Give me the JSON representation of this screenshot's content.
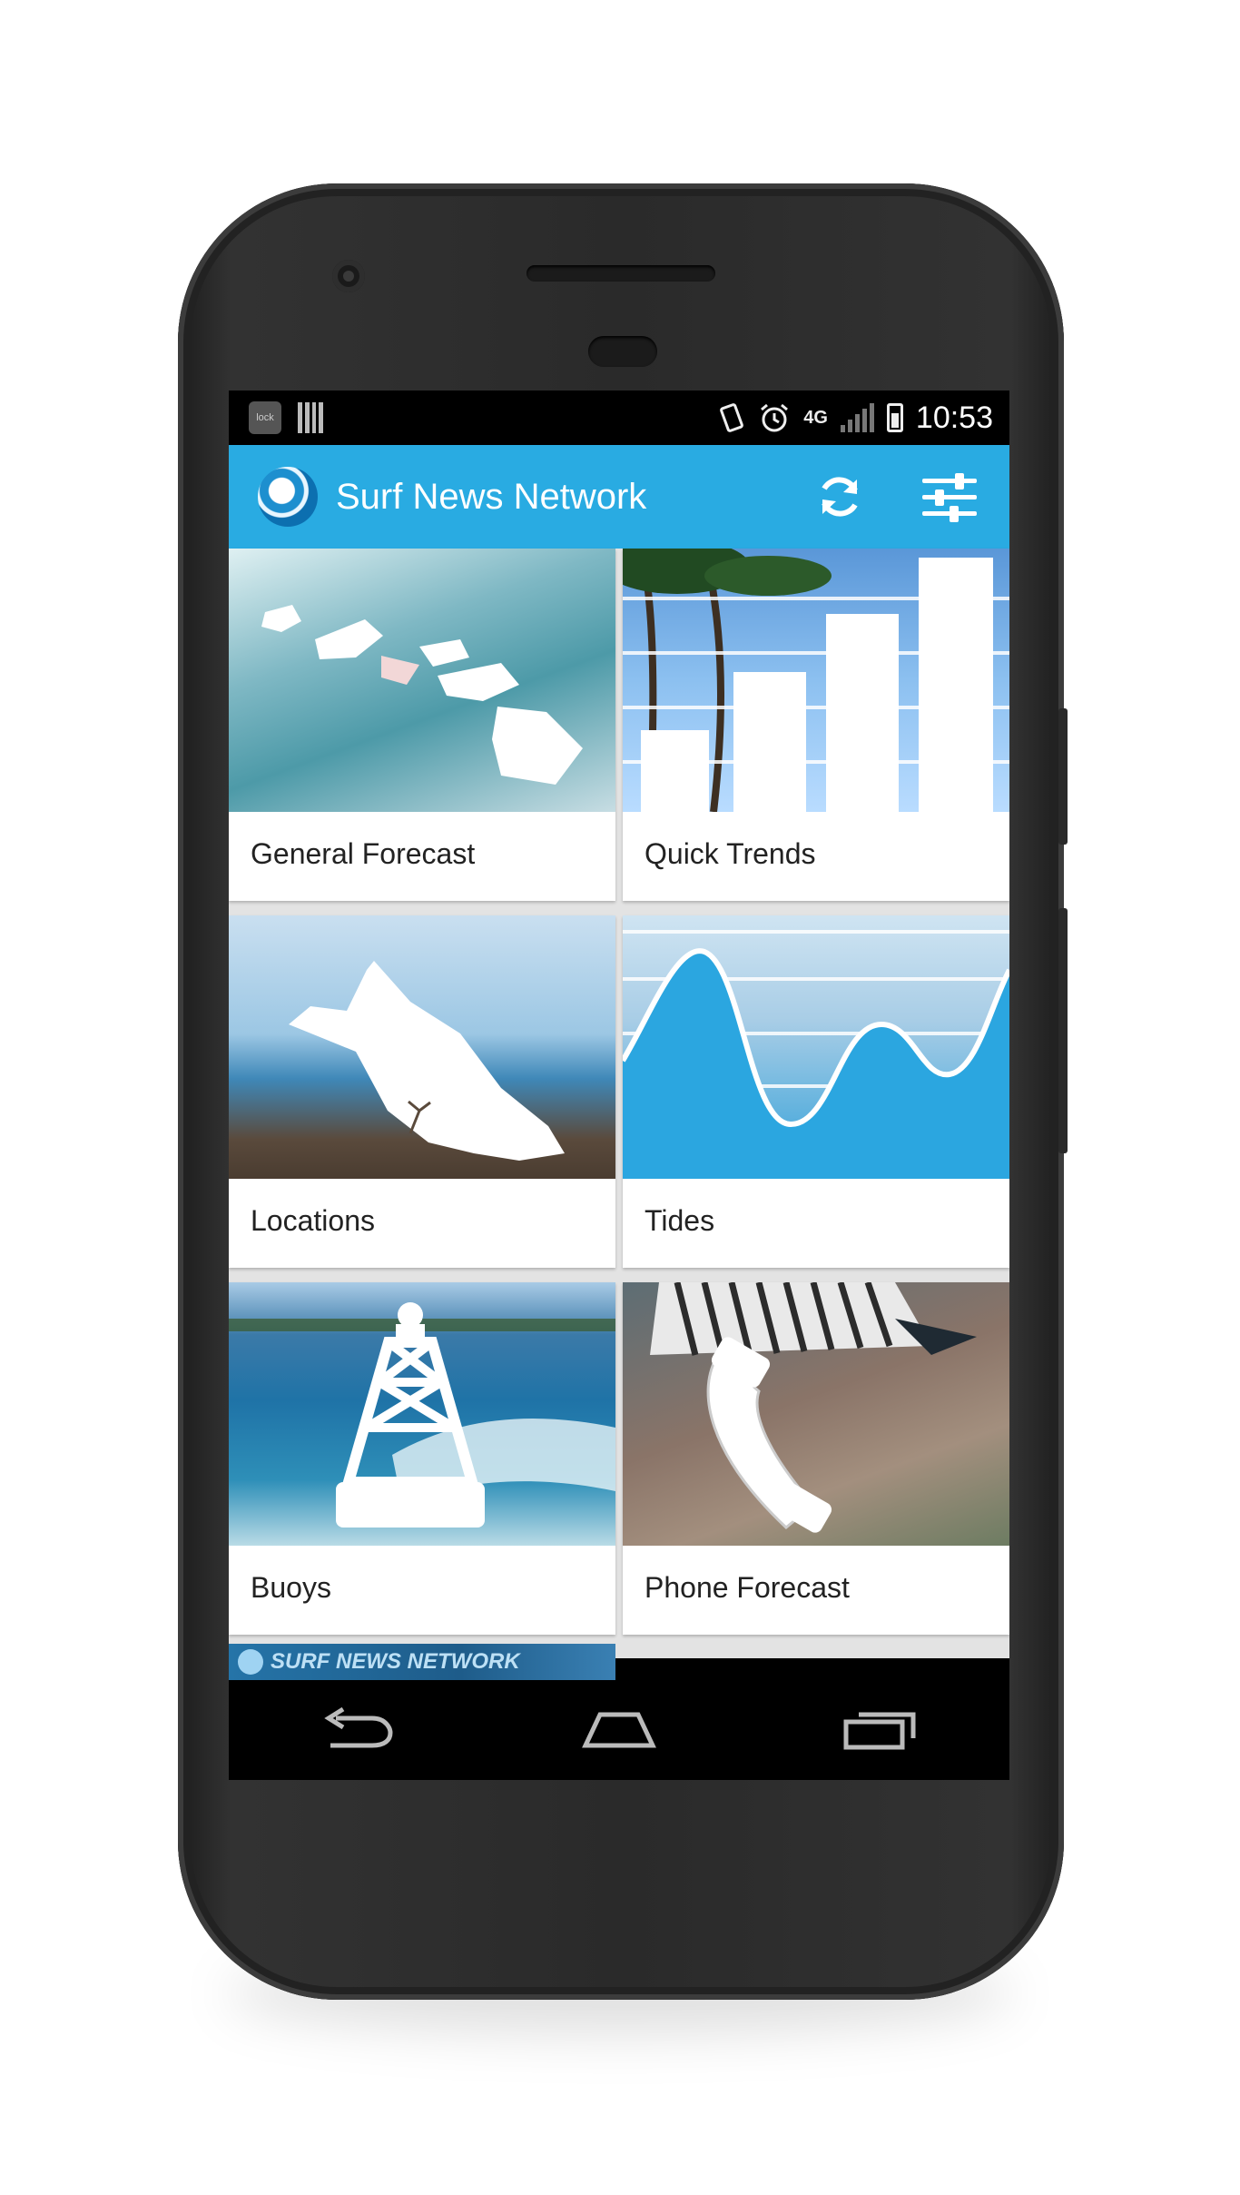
{
  "status_bar": {
    "notification_icons": [
      "lock-app-icon",
      "barcode-icon"
    ],
    "lock_icon_text": "lock",
    "system_icons": [
      "rotate-icon",
      "alarm-icon"
    ],
    "network": "4G",
    "time": "10:53"
  },
  "app_bar": {
    "title": "Surf News Network",
    "actions": [
      "refresh-icon",
      "sliders-icon"
    ]
  },
  "tiles": [
    {
      "label": "General Forecast",
      "image": "hawaii-islands-over-wave"
    },
    {
      "label": "Quick Trends",
      "image": "bar-chart-over-palms"
    },
    {
      "label": "Locations",
      "image": "oahu-island-over-coast"
    },
    {
      "label": "Tides",
      "image": "tide-wave-over-beach"
    },
    {
      "label": "Buoys",
      "image": "buoy-over-ocean"
    },
    {
      "label": "Phone Forecast",
      "image": "phone-handset-over-person"
    }
  ],
  "banner": {
    "text": "SURF NEWS NETWORK"
  },
  "nav_bar": {
    "buttons": [
      "back-icon",
      "home-icon",
      "recents-icon"
    ]
  },
  "colors": {
    "primary": "#29abe2",
    "status_bar": "#000000",
    "grid_bg": "#e3e3e3"
  }
}
